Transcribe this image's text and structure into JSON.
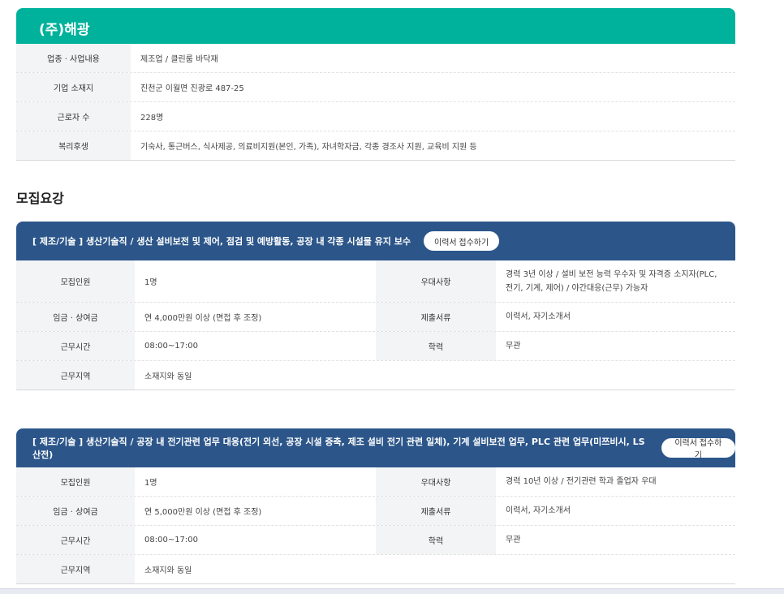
{
  "company": {
    "name": "(주)해광",
    "rows": [
      {
        "label": "업종 · 사업내용",
        "value": "제조업 / 클린룸 바닥재"
      },
      {
        "label": "기업 소재지",
        "value": "진천군 이월면 진광로 487-25"
      },
      {
        "label": "근로자 수",
        "value": "228명"
      },
      {
        "label": "복리후생",
        "value": "기숙사, 통근버스, 식사제공, 의료비지원(본인, 가족), 자녀학자금, 각종 경조사 지원, 교육비 지원 등"
      }
    ]
  },
  "recruit_section_title": "모집요강",
  "jobs": [
    {
      "title": "[ 제조/기술 ] 생산기술직 / 생산 설비보전 및 제어, 점검 및 예방활동, 공장 내 각종 시설물 유지 보수",
      "apply_label": "이력서 접수하기",
      "rows": [
        {
          "l1": "모집인원",
          "v1": "1명",
          "l2": "우대사항",
          "v2": "경력 3년 이상 / 설비 보전 능력 우수자 및 자격증 소지자(PLC, 전기, 기계, 제어) / 야간대응(근무) 가능자"
        },
        {
          "l1": "임금 · 상여금",
          "v1": "연 4,000만원 이상 (면접 후 조정)",
          "l2": "제출서류",
          "v2": "이력서, 자기소개서"
        },
        {
          "l1": "근무시간",
          "v1": "08:00~17:00",
          "l2": "학력",
          "v2": "무관"
        },
        {
          "l1": "근무지역",
          "v1": "소재지와 동일",
          "l2": "",
          "v2": ""
        }
      ]
    },
    {
      "title": "[ 제조/기술 ] 생산기술직 / 공장 내 전기관련 업무 대응(전기 외선, 공장 시설 증축, 제조 설비 전기 관련 일체), 기계 설비보전 업무, PLC 관련 업무(미쯔비시, LS산전)",
      "apply_label": "이력서 접수하기",
      "rows": [
        {
          "l1": "모집인원",
          "v1": "1명",
          "l2": "우대사항",
          "v2": "경력 10년 이상 / 전기관련 학과 졸업자 우대"
        },
        {
          "l1": "임금 · 상여금",
          "v1": "연 5,000만원 이상 (면접 후 조정)",
          "l2": "제출서류",
          "v2": "이력서, 자기소개서"
        },
        {
          "l1": "근무시간",
          "v1": "08:00~17:00",
          "l2": "학력",
          "v2": "무관"
        },
        {
          "l1": "근무지역",
          "v1": "소재지와 동일",
          "l2": "",
          "v2": ""
        }
      ]
    }
  ],
  "colors": {
    "company_header": "#00b29b",
    "job_header": "#2c568a",
    "label_bg": "#f3f4f6"
  }
}
